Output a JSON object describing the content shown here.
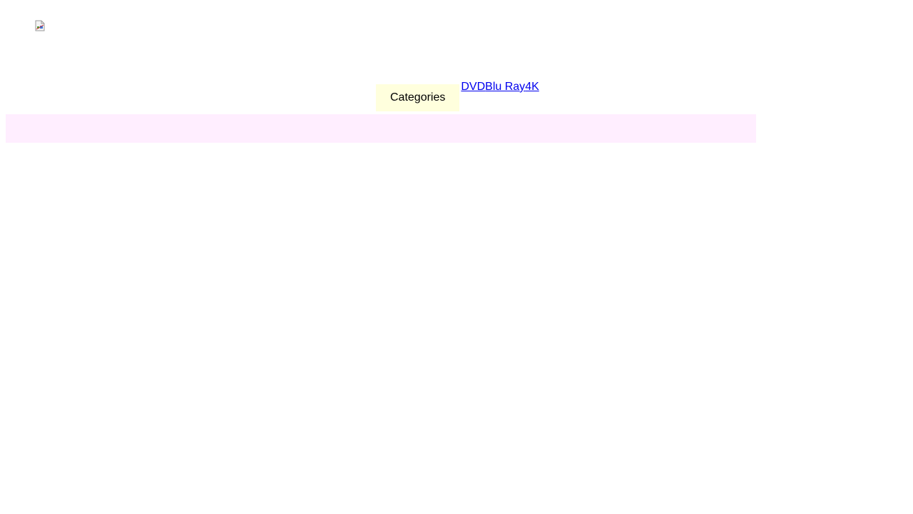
{
  "header": {
    "logo_icon": "broken-image-icon"
  },
  "nav": {
    "categories_label": "Categories",
    "links": [
      {
        "label": "DVD"
      },
      {
        "label": "Blu Ray"
      },
      {
        "label": "4K"
      }
    ]
  },
  "colors": {
    "dropdown_bg": "#ffffdd",
    "bar_bg": "#ffeeff",
    "link": "#0000ee"
  }
}
